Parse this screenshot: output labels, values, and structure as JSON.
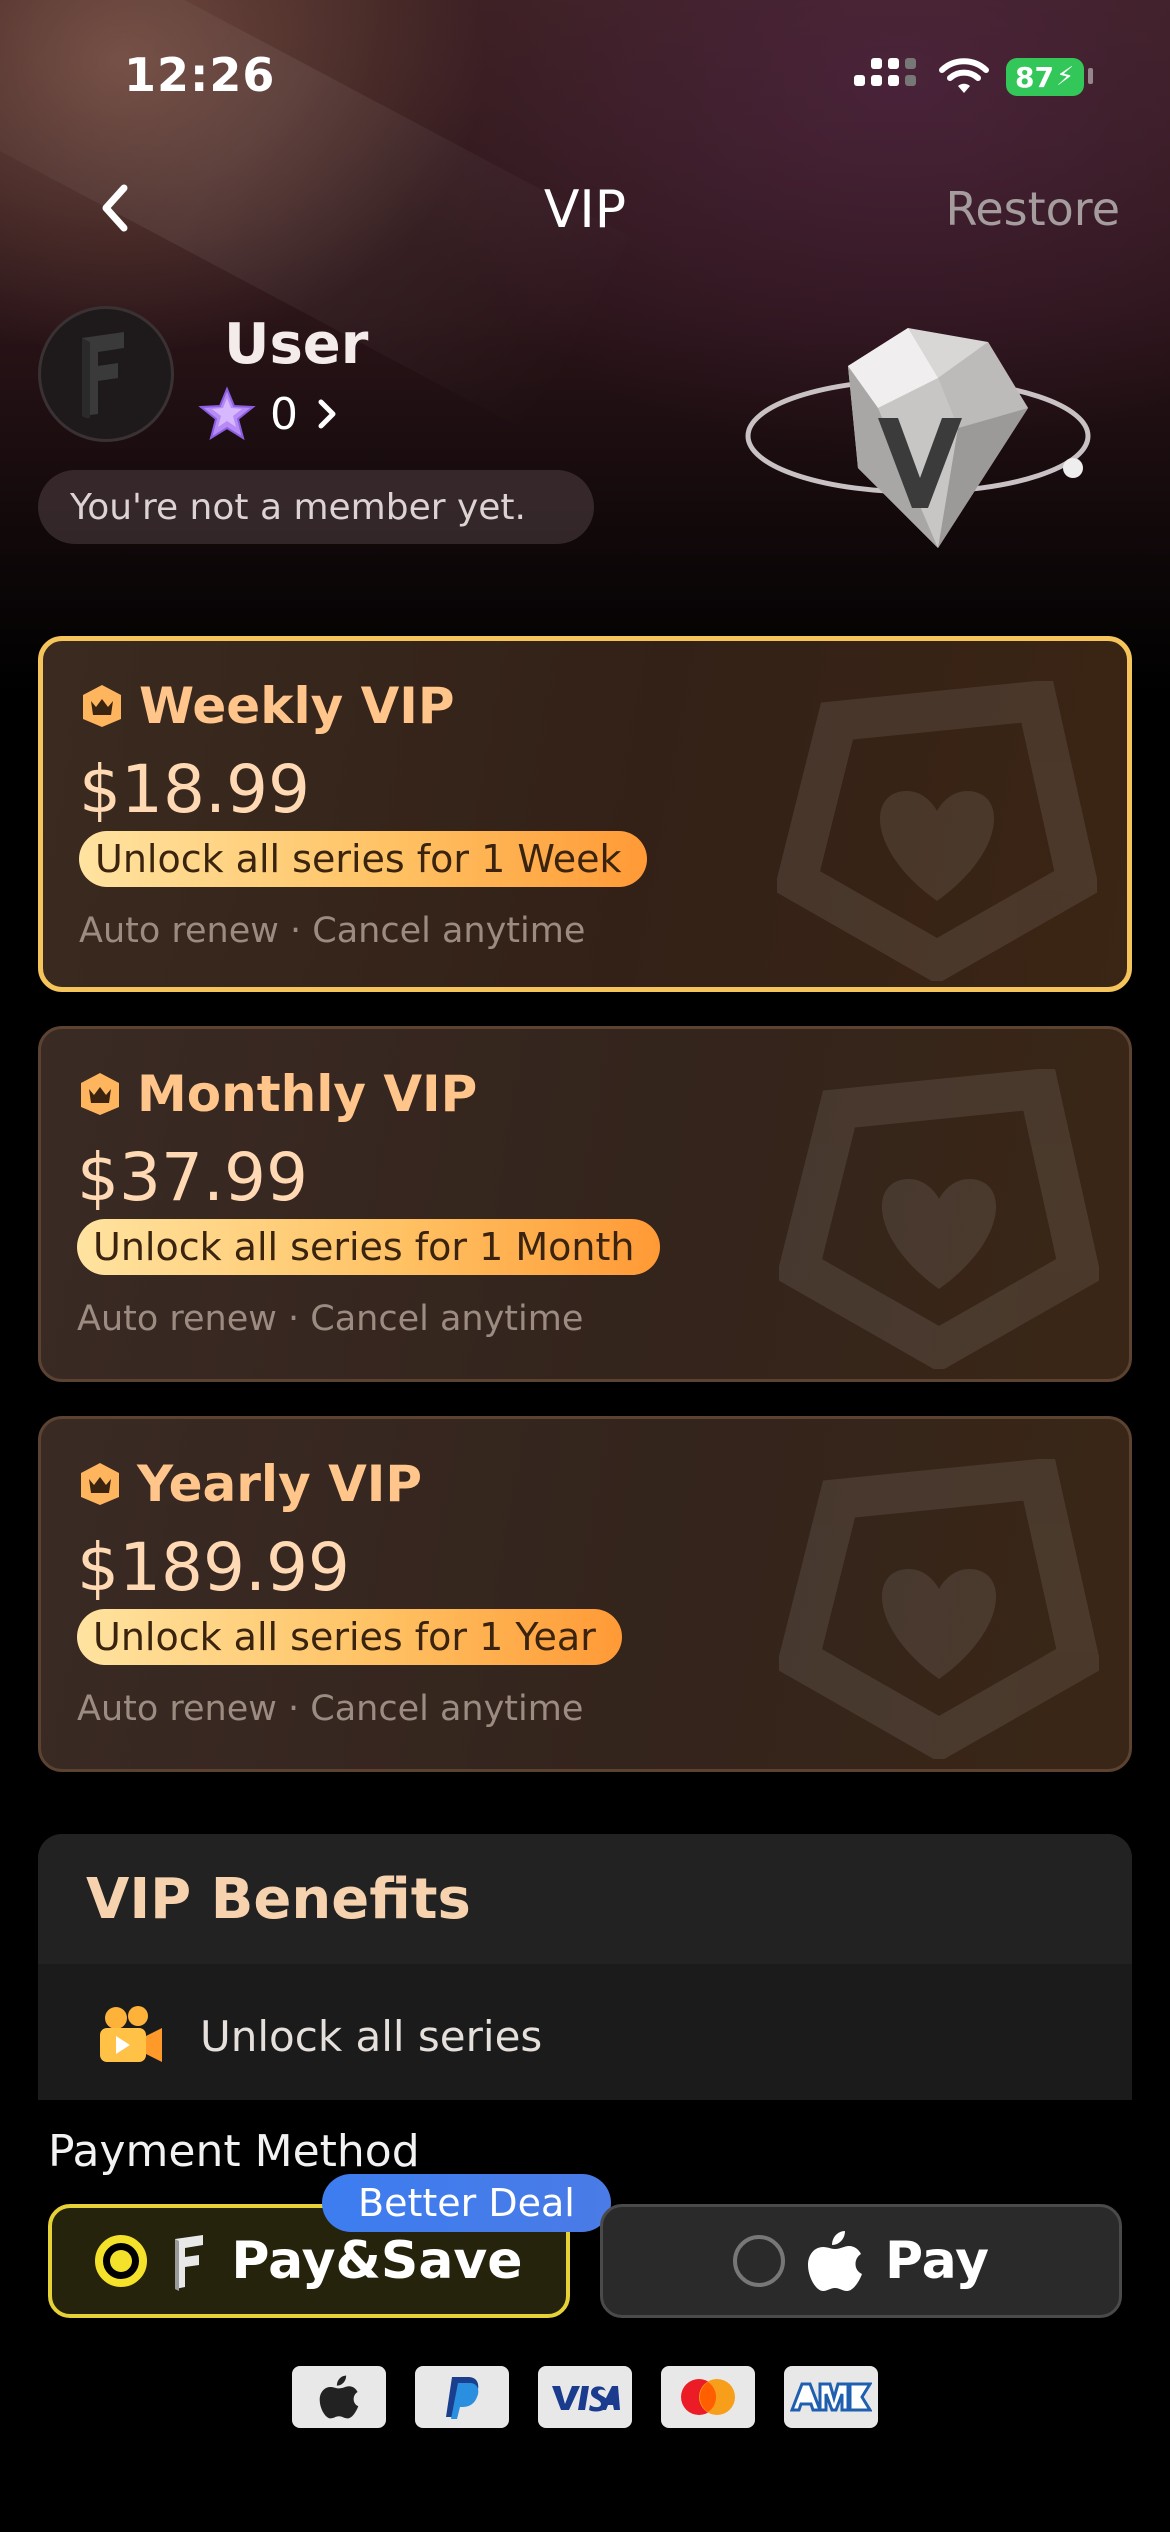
{
  "status_bar": {
    "time": "12:26",
    "battery": "87"
  },
  "nav": {
    "title": "VIP",
    "restore_label": "Restore"
  },
  "profile": {
    "username": "User",
    "coins": "0",
    "membership_status": "You're not a member yet."
  },
  "plans": [
    {
      "name": "Weekly VIP",
      "price": "$18.99",
      "benefit": "Unlock all series for 1 Week",
      "note": "Auto renew · Cancel anytime",
      "selected": true
    },
    {
      "name": "Monthly VIP",
      "price": "$37.99",
      "benefit": "Unlock all series for 1 Month",
      "note": "Auto renew · Cancel anytime",
      "selected": false
    },
    {
      "name": "Yearly VIP",
      "price": "$189.99",
      "benefit": "Unlock all series for 1 Year",
      "note": "Auto renew · Cancel anytime",
      "selected": false
    }
  ],
  "benefits": {
    "title": "VIP Benefits",
    "items": [
      {
        "label": "Unlock all series",
        "icon": "film-camera-icon"
      }
    ]
  },
  "payment": {
    "label": "Payment Method",
    "badge": "Better Deal",
    "options": [
      {
        "label": "Pay&Save",
        "selected": true,
        "icon": "brand-logo-icon"
      },
      {
        "label": "Pay",
        "selected": false,
        "icon": "apple-icon"
      }
    ],
    "accepted_cards": [
      "apple-pay-icon",
      "paypal-icon",
      "visa-icon",
      "mastercard-icon",
      "amex-icon"
    ]
  },
  "colors": {
    "accent_gold": "#f5c55b",
    "plan_title": "#ffc58a",
    "pay_highlight": "#e6d236",
    "badge_blue": "#3d7df0"
  }
}
